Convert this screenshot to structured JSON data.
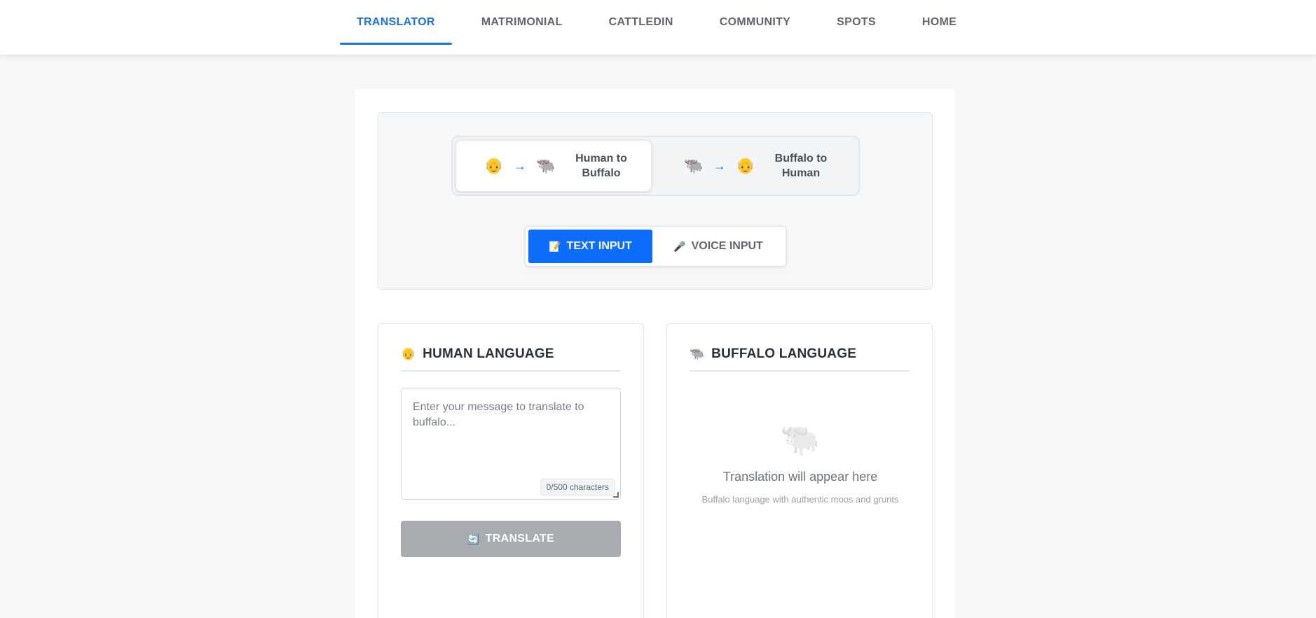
{
  "nav": {
    "items": [
      {
        "label": "TRANSLATOR",
        "active": true
      },
      {
        "label": "MATRIMONIAL"
      },
      {
        "label": "CATTLEDIN"
      },
      {
        "label": "COMMUNITY"
      },
      {
        "label": "SPOTS"
      },
      {
        "label": "HOME"
      }
    ]
  },
  "direction": {
    "human_to_buffalo": {
      "from_emoji": "👴",
      "arrow": "→",
      "to_emoji": "🐃",
      "label": "Human to Buffalo"
    },
    "buffalo_to_human": {
      "from_emoji": "🐃",
      "arrow": "→",
      "to_emoji": "👴",
      "label": "Buffalo to Human"
    }
  },
  "input_mode": {
    "text": {
      "icon": "📝",
      "label": "TEXT INPUT"
    },
    "voice": {
      "icon": "🎤",
      "label": "VOICE INPUT"
    }
  },
  "human_card": {
    "icon": "👴",
    "title": "HUMAN LANGUAGE",
    "placeholder": "Enter your message to translate to buffalo...",
    "value": "",
    "char_count": "0/500 characters",
    "translate_icon": "🔄",
    "translate_label": "TRANSLATE"
  },
  "buffalo_card": {
    "icon": "🐃",
    "title": "BUFFALO LANGUAGE",
    "placeholder_icon": "🐃",
    "placeholder_title": "Translation will appear here",
    "placeholder_sub": "Buffalo language with authentic moos and grunts"
  },
  "colors": {
    "accent": "#1a73e8",
    "primary_button": "#0d6efd",
    "disabled_button": "#a8abaf"
  }
}
